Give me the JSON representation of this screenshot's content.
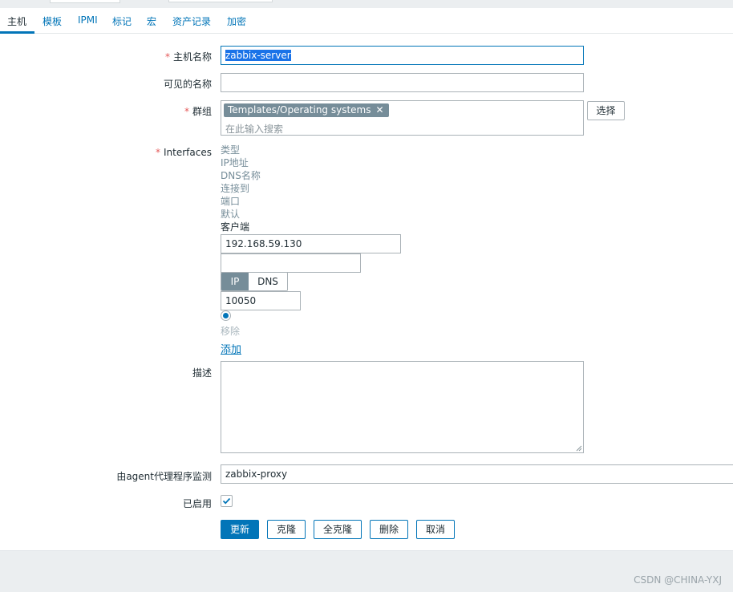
{
  "tabs": [
    {
      "label": "主机"
    },
    {
      "label": "模板"
    },
    {
      "label": "IPMI"
    },
    {
      "label": "标记"
    },
    {
      "label": "宏"
    },
    {
      "label": "资产记录"
    },
    {
      "label": "加密"
    }
  ],
  "form": {
    "host_name": {
      "label": "主机名称",
      "value": "zabbix-server"
    },
    "visible_name": {
      "label": "可见的名称",
      "value": ""
    },
    "groups": {
      "label": "群组",
      "selected": [
        "Templates/Operating systems"
      ],
      "placeholder": "在此输入搜索",
      "select_button": "选择"
    },
    "interfaces": {
      "label": "Interfaces",
      "columns": [
        "类型",
        "IP地址",
        "DNS名称",
        "连接到",
        "端口",
        "默认"
      ],
      "row_type": "客户端",
      "ip": "192.168.59.130",
      "dns": "",
      "connect_ip": "IP",
      "connect_dns": "DNS",
      "port": "10050",
      "remove": "移除",
      "add": "添加"
    },
    "description": {
      "label": "描述",
      "value": ""
    },
    "proxy": {
      "label": "由agent代理程序监测",
      "value": "zabbix-proxy"
    },
    "enabled": {
      "label": "已启用",
      "checked": true
    }
  },
  "buttons": {
    "update": "更新",
    "clone": "克隆",
    "full_clone": "全克隆",
    "delete": "删除",
    "cancel": "取消"
  },
  "watermark": "CSDN @CHINA-YXJ",
  "colors": {
    "accent": "#0275b8",
    "required": "#e45959",
    "chip": "#768d99",
    "footer": "#ebeef0"
  }
}
